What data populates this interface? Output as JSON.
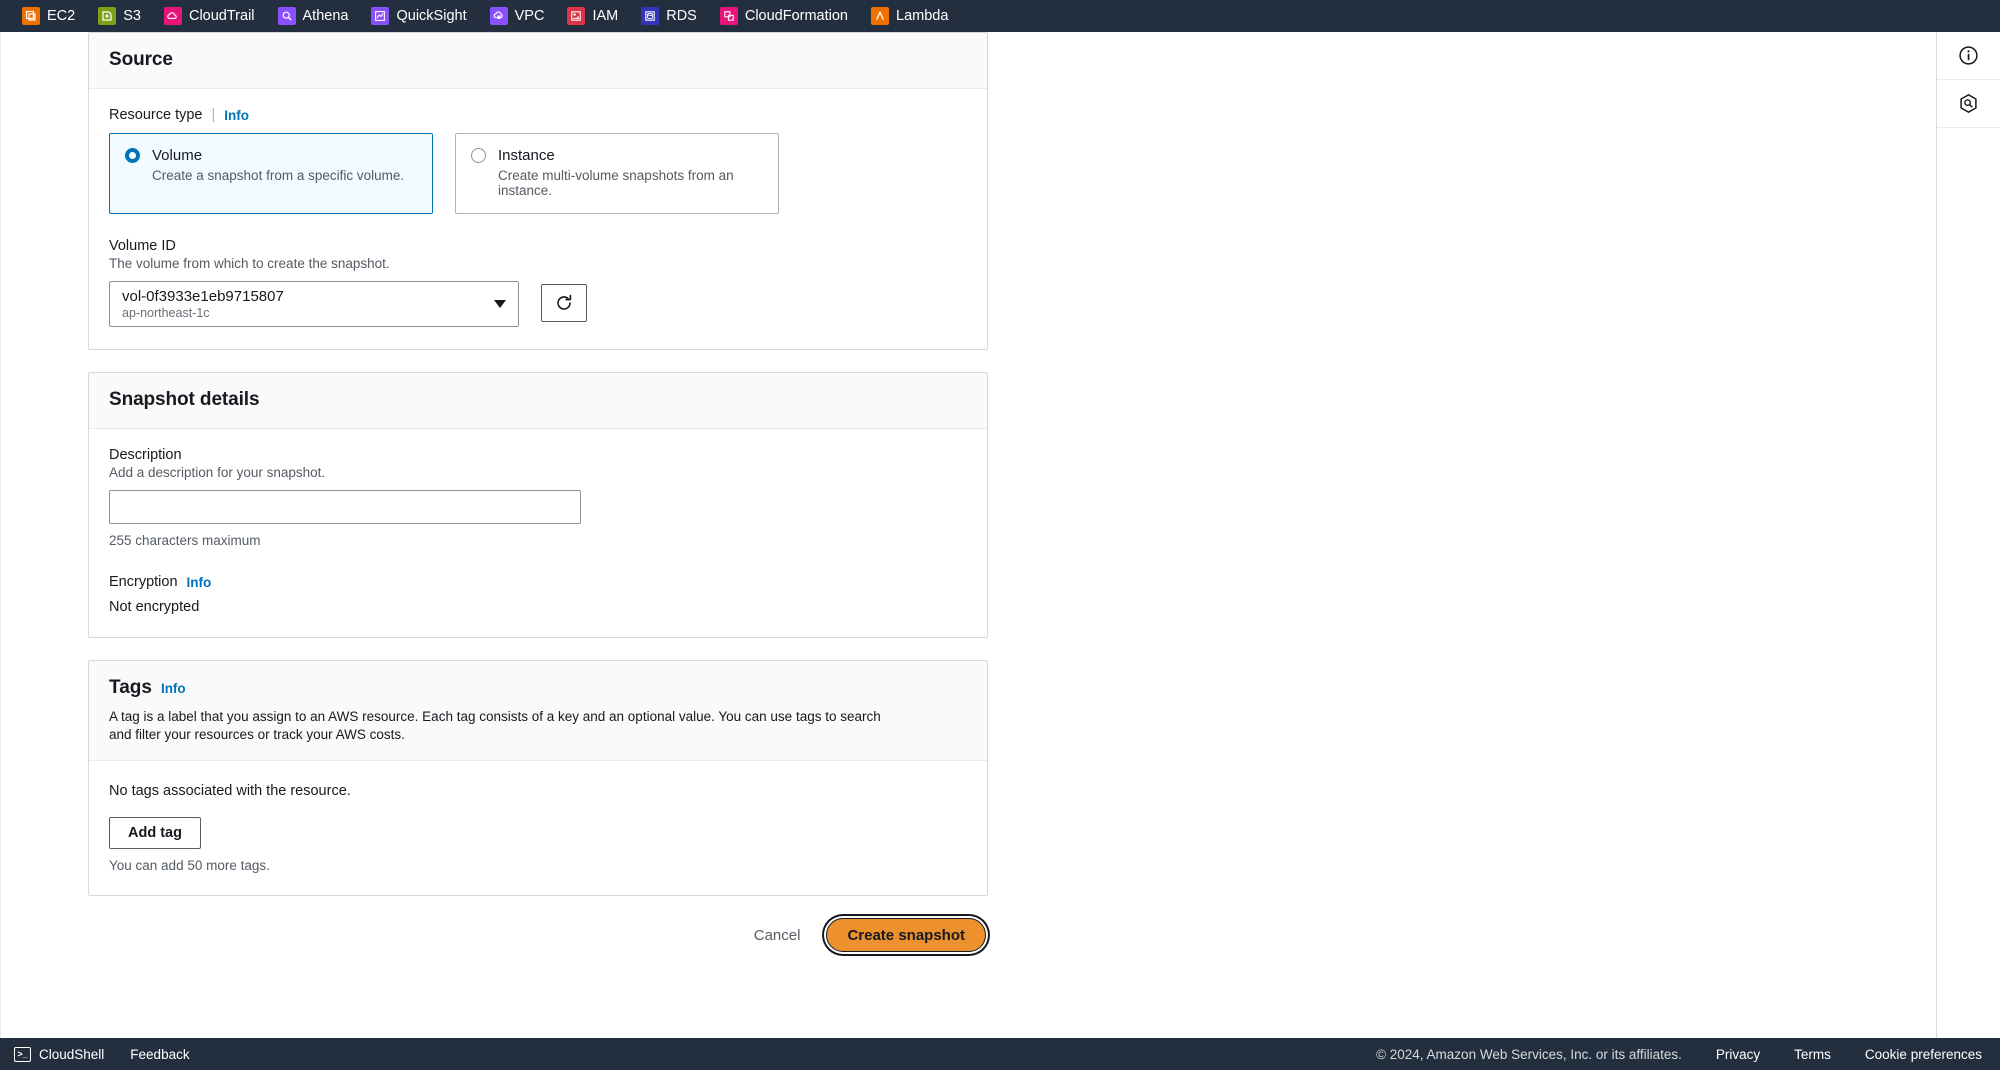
{
  "topnav": {
    "items": [
      {
        "label": "EC2",
        "icon": "ec2-icon",
        "color": "#ed7100"
      },
      {
        "label": "S3",
        "icon": "s3-icon",
        "color": "#7aa116"
      },
      {
        "label": "CloudTrail",
        "icon": "cloudtrail-icon",
        "color": "#e7157b"
      },
      {
        "label": "Athena",
        "icon": "athena-icon",
        "color": "#8c4fff"
      },
      {
        "label": "QuickSight",
        "icon": "quicksight-icon",
        "color": "#8c4fff"
      },
      {
        "label": "VPC",
        "icon": "vpc-icon",
        "color": "#8c4fff"
      },
      {
        "label": "IAM",
        "icon": "iam-icon",
        "color": "#dd344c"
      },
      {
        "label": "RDS",
        "icon": "rds-icon",
        "color": "#3334b9"
      },
      {
        "label": "CloudFormation",
        "icon": "cloudformation-icon",
        "color": "#e7157b"
      },
      {
        "label": "Lambda",
        "icon": "lambda-icon",
        "color": "#ed7100"
      }
    ]
  },
  "source": {
    "title": "Source",
    "resource_type": {
      "label": "Resource type",
      "info": "Info",
      "options": [
        {
          "title": "Volume",
          "description": "Create a snapshot from a specific volume.",
          "selected": true
        },
        {
          "title": "Instance",
          "description": "Create multi-volume snapshots from an instance.",
          "selected": false
        }
      ]
    },
    "volume_id": {
      "label": "Volume ID",
      "description": "The volume from which to create the snapshot.",
      "value": "vol-0f3933e1eb9715807",
      "region": "ap-northeast-1c",
      "refresh_icon": "refresh-icon"
    }
  },
  "snapshot_details": {
    "title": "Snapshot details",
    "description_field": {
      "label": "Description",
      "description": "Add a description for your snapshot.",
      "value": "",
      "placeholder": "",
      "hint": "255 characters maximum"
    },
    "encryption": {
      "label": "Encryption",
      "info": "Info",
      "value": "Not encrypted"
    }
  },
  "tags": {
    "title": "Tags",
    "info": "Info",
    "description": "A tag is a label that you assign to an AWS resource. Each tag consists of a key and an optional value. You can use tags to search and filter your resources or track your AWS costs.",
    "empty_text": "No tags associated with the resource.",
    "add_button": "Add tag",
    "remaining": "You can add 50 more tags."
  },
  "actions": {
    "cancel": "Cancel",
    "submit": "Create snapshot",
    "submit_color": "#ec912d"
  },
  "rail": {
    "info_icon": "info-circle-icon",
    "cloudwatch_icon": "cloudwatch-hexagon-icon"
  },
  "footer": {
    "cloudshell": "CloudShell",
    "feedback": "Feedback",
    "copyright": "© 2024, Amazon Web Services, Inc. or its affiliates.",
    "privacy": "Privacy",
    "terms": "Terms",
    "cookie_preferences": "Cookie preferences"
  }
}
